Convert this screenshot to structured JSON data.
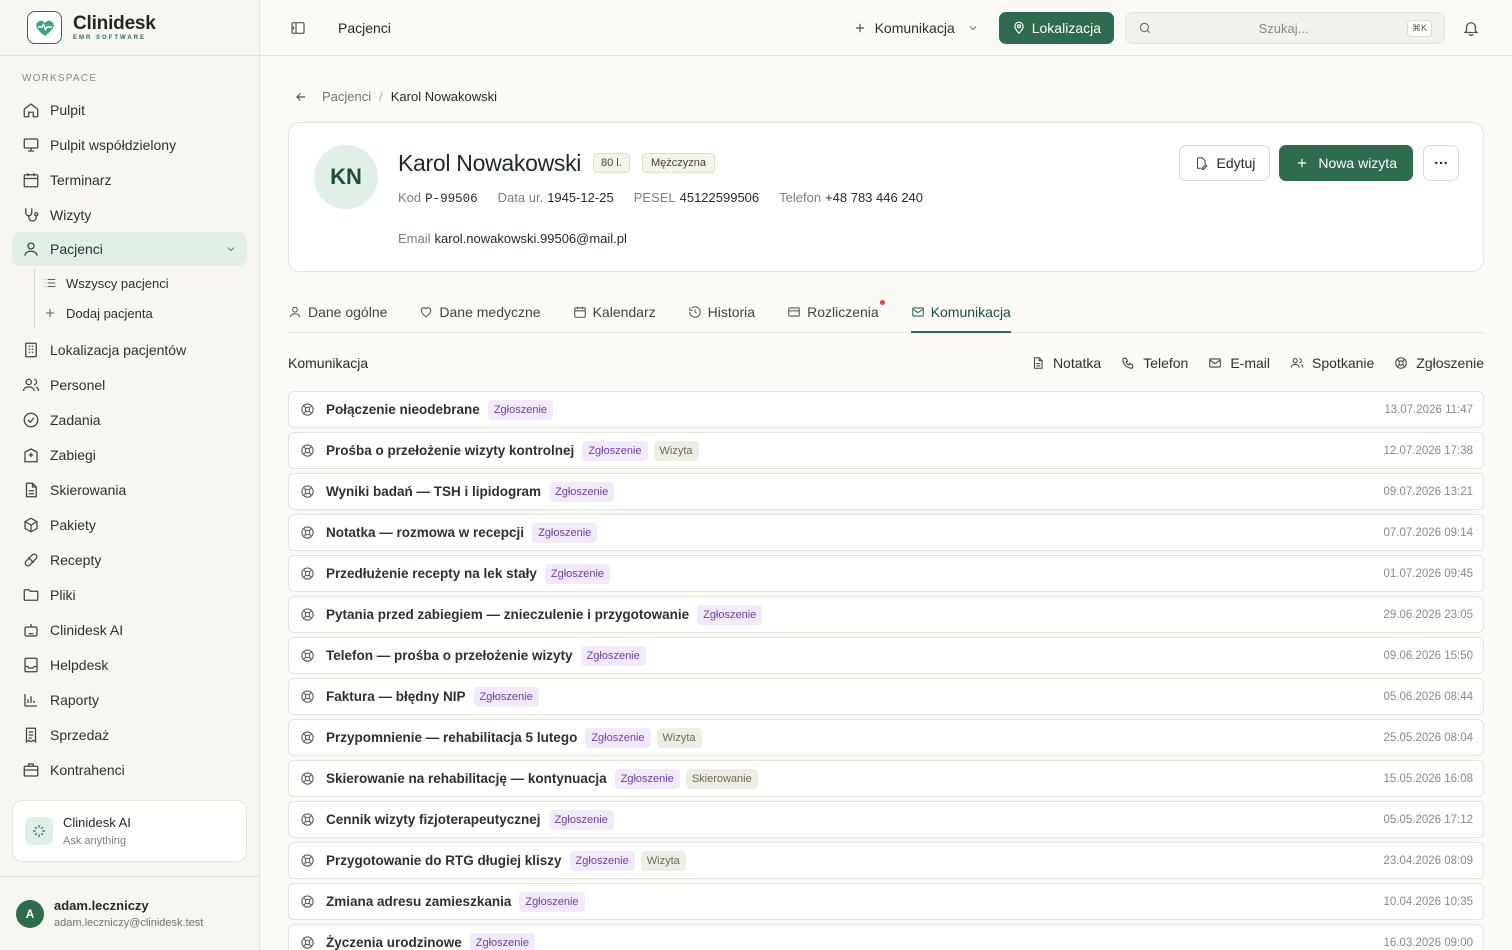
{
  "brand": {
    "name": "Clinidesk",
    "subtitle": "EMR SOFTWARE"
  },
  "sidebar": {
    "section_label": "WORKSPACE",
    "items": [
      {
        "label": "Pulpit",
        "icon": "home-icon"
      },
      {
        "label": "Pulpit współdzielony",
        "icon": "monitor-icon"
      },
      {
        "label": "Terminarz",
        "icon": "calendar-icon"
      },
      {
        "label": "Wizyty",
        "icon": "stethoscope-icon"
      },
      {
        "label": "Pacjenci",
        "icon": "user-icon",
        "active": true
      },
      {
        "label": "Lokalizacja pacjentów",
        "icon": "building-icon"
      },
      {
        "label": "Personel",
        "icon": "users-icon"
      },
      {
        "label": "Zadania",
        "icon": "check-circle-icon"
      },
      {
        "label": "Zabiegi",
        "icon": "hospital-icon"
      },
      {
        "label": "Skierowania",
        "icon": "document-icon"
      },
      {
        "label": "Pakiety",
        "icon": "package-icon"
      },
      {
        "label": "Recepty",
        "icon": "pill-icon"
      },
      {
        "label": "Pliki",
        "icon": "folder-icon"
      },
      {
        "label": "Clinidesk AI",
        "icon": "robot-icon"
      },
      {
        "label": "Helpdesk",
        "icon": "inbox-icon"
      },
      {
        "label": "Raporty",
        "icon": "bar-chart-icon"
      },
      {
        "label": "Sprzedaż",
        "icon": "receipt-icon"
      },
      {
        "label": "Kontrahenci",
        "icon": "briefcase-icon"
      }
    ],
    "subitems": [
      {
        "label": "Wszyscy pacjenci",
        "icon": "list-icon"
      },
      {
        "label": "Dodaj pacjenta",
        "icon": "plus-icon"
      }
    ],
    "ai_card": {
      "title": "Clinidesk AI",
      "subtitle": "Ask anything"
    },
    "user": {
      "initial": "A",
      "name": "adam.leczniczy",
      "email": "adam.leczniczy@clinidesk.test"
    }
  },
  "topbar": {
    "title": "Pacjenci",
    "komunikacja_label": "Komunikacja",
    "lokalizacja_label": "Lokalizacja",
    "search_placeholder": "Szukaj...",
    "search_shortcut": "⌘K"
  },
  "breadcrumb": {
    "parent": "Pacjenci",
    "current": "Karol Nowakowski"
  },
  "patient": {
    "initials": "KN",
    "name": "Karol Nowakowski",
    "age": "80 l.",
    "sex": "Mężczyzna",
    "code_label": "Kod",
    "code": "P-99506",
    "dob_label": "Data ur.",
    "dob": "1945-12-25",
    "pesel_label": "PESEL",
    "pesel": "45122599506",
    "phone_label": "Telefon",
    "phone": "+48 783 446 240",
    "email_label": "Email",
    "email": "karol.nowakowski.99506@mail.pl"
  },
  "actions": {
    "edit": "Edytuj",
    "new_visit": "Nowa wizyta"
  },
  "tabs": [
    {
      "label": "Dane ogólne",
      "icon": "user-icon"
    },
    {
      "label": "Dane medyczne",
      "icon": "heart-icon"
    },
    {
      "label": "Kalendarz",
      "icon": "calendar-icon"
    },
    {
      "label": "Historia",
      "icon": "history-icon"
    },
    {
      "label": "Rozliczenia",
      "icon": "credit-card-icon",
      "dot": true
    },
    {
      "label": "Komunikacja",
      "icon": "mail-icon",
      "active": true
    }
  ],
  "communication": {
    "title": "Komunikacja",
    "filters": [
      {
        "label": "Notatka",
        "icon": "note-icon"
      },
      {
        "label": "Telefon",
        "icon": "phone-icon"
      },
      {
        "label": "E-mail",
        "icon": "mail-icon"
      },
      {
        "label": "Spotkanie",
        "icon": "users-icon"
      },
      {
        "label": "Zgłoszenie",
        "icon": "lifebuoy-icon"
      }
    ],
    "items": [
      {
        "title": "Połączenie nieodebrane",
        "badges": [
          "Zgłoszenie"
        ],
        "date": "13.07.2026 11:47"
      },
      {
        "title": "Prośba o przełożenie wizyty kontrolnej",
        "badges": [
          "Zgłoszenie",
          "Wizyta"
        ],
        "date": "12.07.2026 17:38"
      },
      {
        "title": "Wyniki badań — TSH i lipidogram",
        "badges": [
          "Zgłoszenie"
        ],
        "date": "09.07.2026 13:21"
      },
      {
        "title": "Notatka — rozmowa w recepcji",
        "badges": [
          "Zgłoszenie"
        ],
        "date": "07.07.2026 09:14"
      },
      {
        "title": "Przedłużenie recepty na lek stały",
        "badges": [
          "Zgłoszenie"
        ],
        "date": "01.07.2026 09:45"
      },
      {
        "title": "Pytania przed zabiegiem — znieczulenie i przygotowanie",
        "badges": [
          "Zgłoszenie"
        ],
        "date": "29.06.2026 23:05"
      },
      {
        "title": "Telefon — prośba o przełożenie wizyty",
        "badges": [
          "Zgłoszenie"
        ],
        "date": "09.06.2026 15:50"
      },
      {
        "title": "Faktura — błędny NIP",
        "badges": [
          "Zgłoszenie"
        ],
        "date": "05.06.2026 08:44"
      },
      {
        "title": "Przypomnienie — rehabilitacja 5 lutego",
        "badges": [
          "Zgłoszenie",
          "Wizyta"
        ],
        "date": "25.05.2026 08:04"
      },
      {
        "title": "Skierowanie na rehabilitację — kontynuacja",
        "badges": [
          "Zgłoszenie",
          "Skierowanie"
        ],
        "date": "15.05.2026 16:08"
      },
      {
        "title": "Cennik wizyty fizjoterapeutycznej",
        "badges": [
          "Zgłoszenie"
        ],
        "date": "05.05.2026 17:12"
      },
      {
        "title": "Przygotowanie do RTG długiej kliszy",
        "badges": [
          "Zgłoszenie",
          "Wizyta"
        ],
        "date": "23.04.2026 08:09"
      },
      {
        "title": "Zmiana adresu zamieszkania",
        "badges": [
          "Zgłoszenie"
        ],
        "date": "10.04.2026 10:35"
      },
      {
        "title": "Życzenia urodzinowe",
        "badges": [
          "Zgłoszenie"
        ],
        "date": "16.03.2026 09:00"
      }
    ]
  },
  "colors": {
    "primary": "#2f6b4f",
    "active_bg": "#e2efe6",
    "badge_purple_bg": "#f2e9fb",
    "badge_purple_text": "#6e3fa3",
    "dot_red": "#d9463b"
  }
}
